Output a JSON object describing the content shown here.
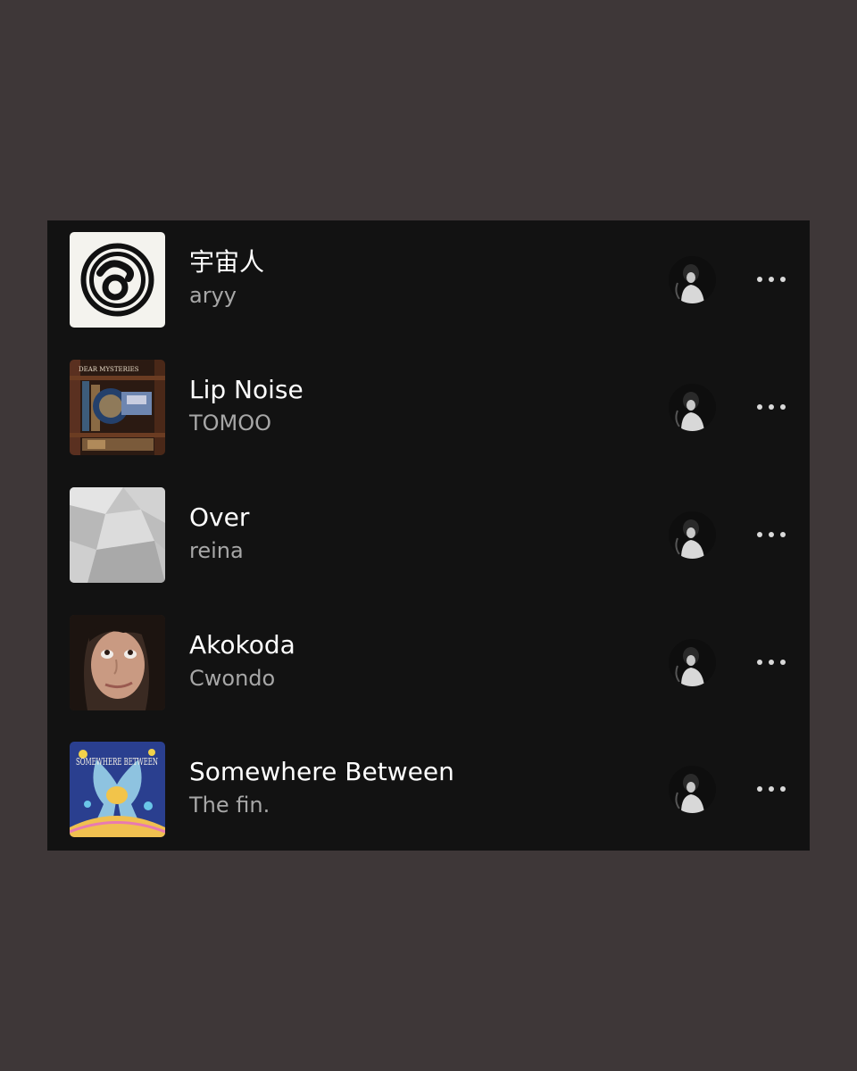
{
  "colors": {
    "background": "#3e3738",
    "panel": "#121212",
    "title": "#ffffff",
    "subtitle": "#a7a7a7"
  },
  "tracks": [
    {
      "title": "宇宙人",
      "artist": "aryy",
      "artwork": "aryy-logo-artwork"
    },
    {
      "title": "Lip Noise",
      "artist": "TOMOO",
      "artwork": "bookshelf-artwork",
      "artwork_text": "DEAR MYSTERIES"
    },
    {
      "title": "Over",
      "artist": "reina",
      "artwork": "grey-paper-artwork"
    },
    {
      "title": "Akokoda",
      "artist": "Cwondo",
      "artwork": "face-photo-artwork"
    },
    {
      "title": "Somewhere Between",
      "artist": "The fin.",
      "artwork": "somewhere-between-artwork",
      "artwork_text": "SOMEWHERE BETWEEN"
    }
  ],
  "row_avatar": "user-avatar",
  "more_icon": "more-options-icon"
}
